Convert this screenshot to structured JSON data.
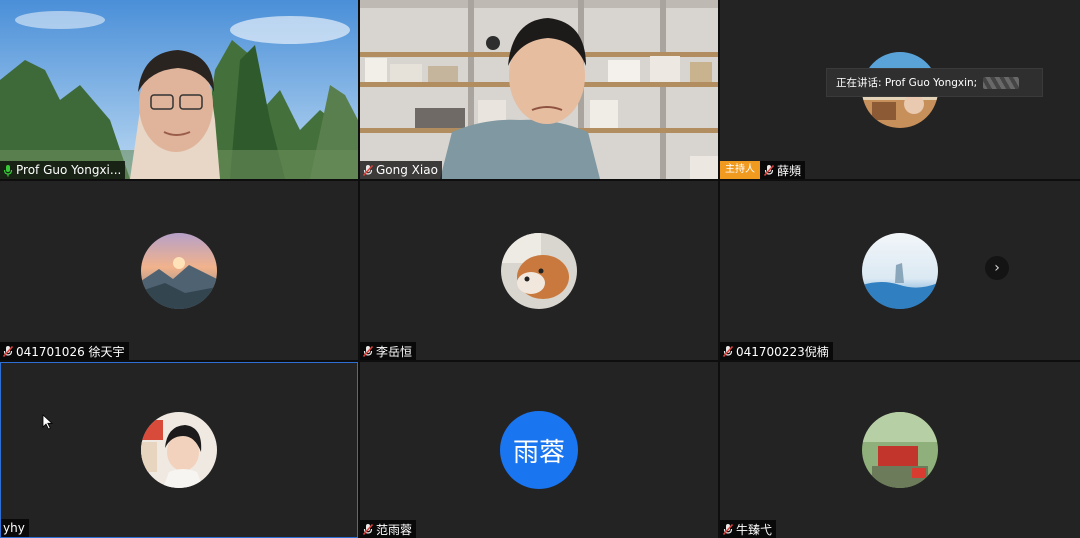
{
  "speaking_banner": {
    "label": "正在讲话: Prof Guo Yongxin;"
  },
  "next_page": {
    "icon": "chevron-right-icon",
    "glyph": "›"
  },
  "host_badge": "主持人",
  "colors": {
    "tile_bg": "#232323",
    "active_border": "#2e6fd6",
    "host_badge": "#f09a20",
    "text_avatar": "#1a75f0"
  },
  "participants": [
    {
      "name": "Prof Guo Yongxi...",
      "mic": "mic-active-icon",
      "view": "video"
    },
    {
      "name": "Gong Xiao",
      "mic": "mic-muted-icon",
      "view": "video"
    },
    {
      "name": "薛頻",
      "mic": "mic-muted-icon",
      "view": "avatar",
      "host": true
    },
    {
      "name": "041701026 徐天宇",
      "mic": "mic-muted-icon",
      "view": "avatar"
    },
    {
      "name": "李岳恒",
      "mic": "mic-muted-icon",
      "view": "avatar"
    },
    {
      "name": "041700223倪楠",
      "mic": "mic-muted-icon",
      "view": "avatar"
    },
    {
      "name": "yhy",
      "mic": "none",
      "view": "avatar",
      "active": true
    },
    {
      "name": "范雨蓉",
      "mic": "mic-muted-icon",
      "view": "text-avatar",
      "avatar_text": "雨蓉"
    },
    {
      "name": "牛臻弋",
      "mic": "mic-muted-icon",
      "view": "avatar"
    }
  ]
}
